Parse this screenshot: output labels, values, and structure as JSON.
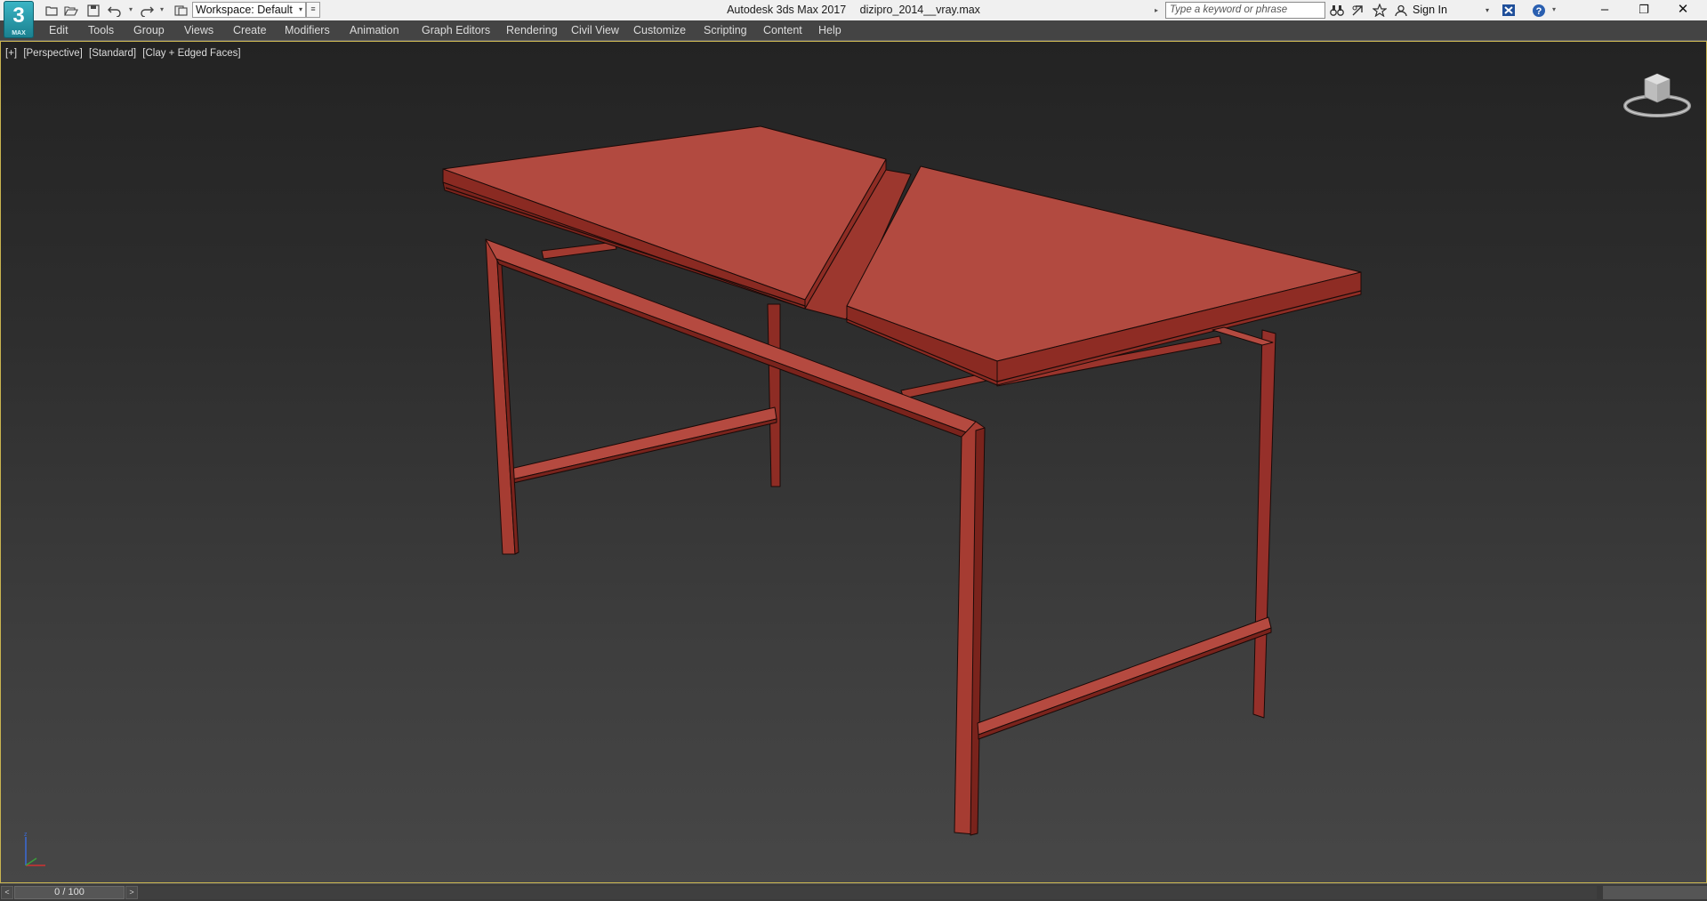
{
  "app": {
    "logo_text": "3",
    "logo_subtext": "MAX",
    "title": "Autodesk 3ds Max 2017",
    "filename": "dizipro_2014__vray.max"
  },
  "quick_access": {
    "icons": [
      "new-file-icon",
      "open-file-icon",
      "save-icon",
      "undo-icon",
      "redo-icon",
      "project-folder-icon"
    ],
    "workspace_label": "Workspace: Default"
  },
  "search": {
    "placeholder": "Type a keyword or phrase"
  },
  "infocenter": {
    "icons": [
      "binoculars-icon",
      "communication-center-icon",
      "favorites-star-icon",
      "user-icon"
    ],
    "signin_label": "Sign In",
    "exchange_icon": "autodesk-exchange-icon",
    "help_icon": "help-icon"
  },
  "window_controls": {
    "minimize": "–",
    "restore": "❐",
    "close": "✕"
  },
  "menu": {
    "items": [
      "Edit",
      "Tools",
      "Group",
      "Views",
      "Create",
      "Modifiers",
      "Animation",
      "Graph Editors",
      "Rendering",
      "Civil View",
      "Customize",
      "Scripting",
      "Content",
      "Help"
    ]
  },
  "viewport": {
    "labels": [
      "[+]",
      "[Perspective]",
      "[Standard]",
      "[Clay + Edged Faces]"
    ],
    "model_color": "#b24a40",
    "model_dark": "#8a2a22",
    "background_top": "#232323",
    "background_bottom": "#474747"
  },
  "timeline": {
    "left_arrow": "<",
    "right_arrow": ">",
    "frame_display": "0 / 100"
  }
}
